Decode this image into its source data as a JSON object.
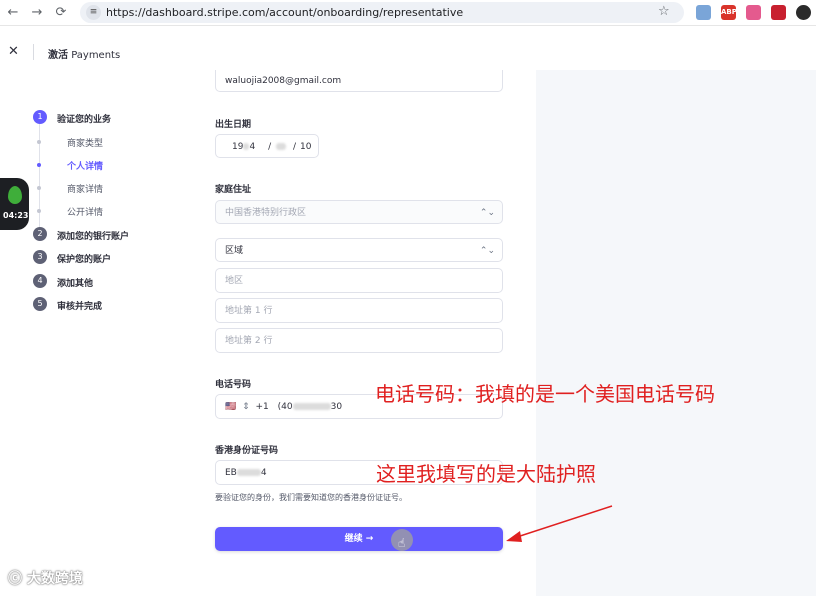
{
  "browser": {
    "url": "https://dashboard.stripe.com/account/onboarding/representative",
    "back_icon": "←",
    "forward_icon": "→",
    "reload_icon": "⟳"
  },
  "header": {
    "close_icon": "✕",
    "title_prefix": "激活",
    "title_name": "Payments"
  },
  "timer": {
    "text": "04:23"
  },
  "steps": [
    {
      "num": "1",
      "label": "验证您的业务",
      "active": true
    },
    {
      "num": "2",
      "label": "添加您的银行账户"
    },
    {
      "num": "3",
      "label": "保护您的账户"
    },
    {
      "num": "4",
      "label": "添加其他"
    },
    {
      "num": "5",
      "label": "审核并完成"
    }
  ],
  "substeps": [
    {
      "label": "商家类型"
    },
    {
      "label": "个人详情",
      "active": true
    },
    {
      "label": "商家详情"
    },
    {
      "label": "公开详情"
    }
  ],
  "form": {
    "email_value": "waluojia2008@gmail.com",
    "dob_label": "出生日期",
    "dob_year": "19",
    "dob_year_tail": "4",
    "dob_sep": "/",
    "dob_day": "10",
    "address_label": "家庭住址",
    "country_placeholder": "中国香港特别行政区",
    "region_value": "区域",
    "district_placeholder": "地区",
    "line1_placeholder": "地址第 1 行",
    "line2_placeholder": "地址第 2 行",
    "phone_label": "电话号码",
    "phone_flag": "🇺🇸",
    "phone_code": "+1",
    "phone_prefix": "(40",
    "phone_suffix": "30",
    "id_label": "香港身份证号码",
    "id_prefix": "EB",
    "id_suffix": "4",
    "helper_text": "要验证您的身份，我们需要知道您的香港身份证证号。",
    "continue_label": "继续 →"
  },
  "annotations": {
    "phone_note": "电话号码：我填的是一个美国电话号码",
    "id_note": "这里我填写的是大陆护照",
    "color": "#e02020"
  },
  "watermark": "大数跨境",
  "colors": {
    "accent": "#635bff"
  }
}
